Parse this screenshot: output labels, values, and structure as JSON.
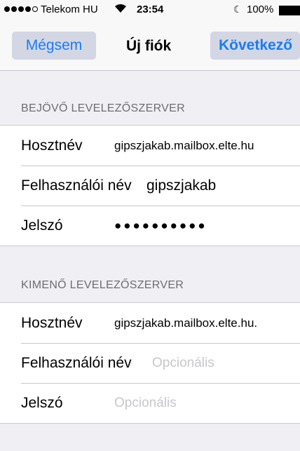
{
  "status_bar": {
    "carrier": "Telekom HU",
    "time": "23:54",
    "battery": "100%",
    "signal_bars": 4,
    "signal_total": 5
  },
  "nav": {
    "cancel_label": "Mégsem",
    "title": "Új fiók",
    "next_label": "Következő",
    "accent_color": "#1a7cf5"
  },
  "incoming": {
    "header": "BEJÖVŐ LEVELEZŐSZERVER",
    "rows": [
      {
        "label": "Hosztnév",
        "value": "gipszjakab.mailbox.elte.hu"
      },
      {
        "label": "Felhasználói név",
        "value": "gipszjakab"
      },
      {
        "label": "Jelszó",
        "value": "●●●●●●●●●●"
      }
    ]
  },
  "outgoing": {
    "header": "KIMENŐ LEVELEZŐSZERVER",
    "rows": [
      {
        "label": "Hosztnév",
        "value": "gipszjakab.mailbox.elte.hu."
      },
      {
        "label": "Felhasználói név",
        "placeholder": "Opcionális"
      },
      {
        "label": "Jelszó",
        "placeholder": "Opcionális"
      }
    ]
  }
}
